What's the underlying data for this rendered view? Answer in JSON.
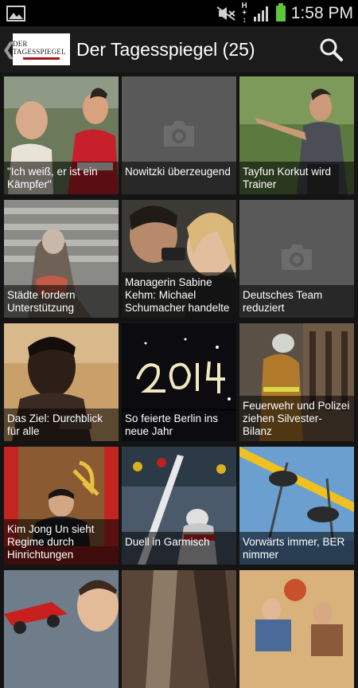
{
  "status_bar": {
    "time": "1:58 PM",
    "icons": [
      "gallery-icon",
      "mute-icon",
      "h-plus-icon",
      "signal-icon",
      "battery-icon"
    ]
  },
  "action_bar": {
    "back_glyph": "❮",
    "logo_text": "DER TAGESSPIEGEL",
    "title": "Der Tagesspiegel (25)",
    "search_icon": "search-icon"
  },
  "articles": [
    {
      "title": "\"Ich weiß, er ist ein Kämpfer\""
    },
    {
      "title": "Nowitzki überzeugend"
    },
    {
      "title": "Tayfun Korkut wird Trainer"
    },
    {
      "title": "Städte fordern Unterstützung"
    },
    {
      "title": "Managerin Sabine Kehm: Michael Schumacher handelte"
    },
    {
      "title": "Deutsches Team reduziert"
    },
    {
      "title": "Das Ziel: Durchblick für alle"
    },
    {
      "title": "So feierte Berlin ins neue Jahr"
    },
    {
      "title": "Feuerwehr und Polizei ziehen Silvester-Bilanz"
    },
    {
      "title": "Kim Jong Un sieht Regime durch Hinrichtungen"
    },
    {
      "title": "Duell in Garmisch"
    },
    {
      "title": "Vorwärts immer, BER nimmer"
    },
    {
      "title": ""
    },
    {
      "title": ""
    },
    {
      "title": ""
    }
  ]
}
